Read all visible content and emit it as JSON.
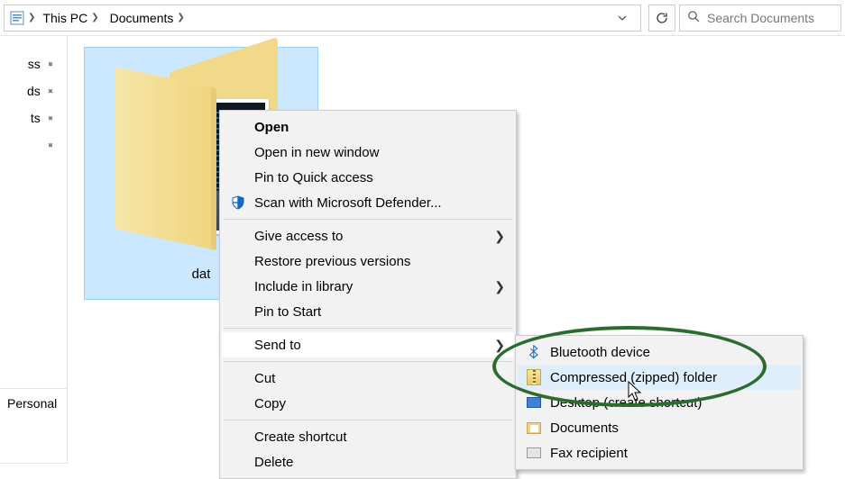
{
  "breadcrumb": {
    "items": [
      "This PC",
      "Documents"
    ]
  },
  "search": {
    "placeholder": "Search Documents"
  },
  "nav": {
    "items": [
      {
        "label": "ss",
        "pinned": true
      },
      {
        "label": "ds",
        "pinned": true
      },
      {
        "label": "ts",
        "pinned": true
      },
      {
        "label": "",
        "pinned": true
      }
    ],
    "section_label": "Personal"
  },
  "folder": {
    "label": "dat"
  },
  "context_menu": {
    "items": [
      {
        "label": "Open",
        "bold": true
      },
      {
        "label": "Open in new window"
      },
      {
        "label": "Pin to Quick access"
      },
      {
        "label": "Scan with Microsoft Defender...",
        "icon": "shield"
      },
      {
        "sep": true
      },
      {
        "label": "Give access to",
        "submenu": true
      },
      {
        "label": "Restore previous versions"
      },
      {
        "label": "Include in library",
        "submenu": true
      },
      {
        "label": "Pin to Start"
      },
      {
        "sep": true
      },
      {
        "label": "Send to",
        "submenu": true,
        "hovered": true
      },
      {
        "sep": true
      },
      {
        "label": "Cut"
      },
      {
        "label": "Copy"
      },
      {
        "sep": true
      },
      {
        "label": "Create shortcut"
      },
      {
        "label": "Delete"
      }
    ]
  },
  "send_to_menu": {
    "items": [
      {
        "label": "Bluetooth device",
        "icon": "bluetooth"
      },
      {
        "label": "Compressed (zipped) folder",
        "icon": "zip",
        "highlighted": true
      },
      {
        "label": "Desktop (create shortcut)",
        "icon": "desktop"
      },
      {
        "label": "Documents",
        "icon": "docfolder"
      },
      {
        "label": "Fax recipient",
        "icon": "fax"
      }
    ]
  }
}
